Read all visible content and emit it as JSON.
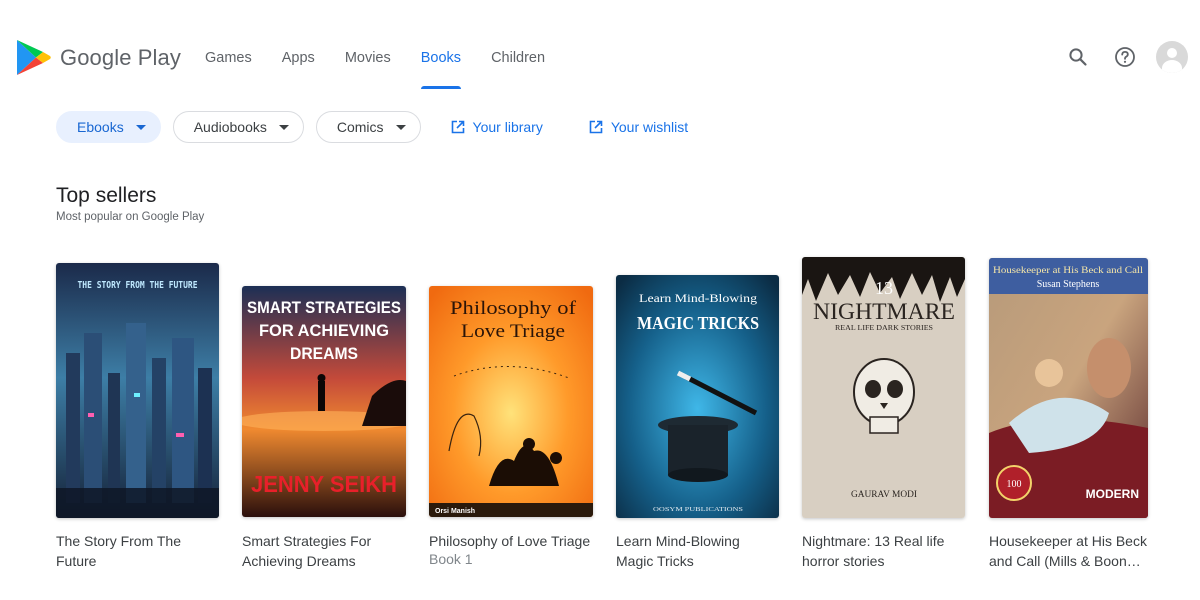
{
  "header": {
    "logo_text": "Google Play",
    "nav_tabs": [
      {
        "label": "Games"
      },
      {
        "label": "Apps"
      },
      {
        "label": "Movies"
      },
      {
        "label": "Books",
        "active": true
      },
      {
        "label": "Children"
      }
    ],
    "icons": [
      "search-icon",
      "help-icon",
      "avatar"
    ]
  },
  "filters": {
    "chips": [
      {
        "label": "Ebooks",
        "selected": true
      },
      {
        "label": "Audiobooks"
      },
      {
        "label": "Comics"
      }
    ],
    "links": [
      {
        "label": "Your library",
        "icon": "open-in-new-icon"
      },
      {
        "label": "Your wishlist",
        "icon": "open-in-new-icon"
      }
    ]
  },
  "section": {
    "title": "Top sellers",
    "subtitle": "Most popular on Google Play"
  },
  "books": [
    {
      "title": "The Story From The Future",
      "cover_text": "THE STORY FROM THE FUTURE"
    },
    {
      "title": "Smart Strategies For Achieving Dreams",
      "cover_text": "SMART STRATEGIES FOR ACHIEVING DREAMS",
      "cover_author": "JENNY SEIKH"
    },
    {
      "title": "Philosophy of Love Triage",
      "subtitle": "Book 1",
      "cover_text": "Philosophy of Love Triage",
      "cover_author": "Orsi Manish"
    },
    {
      "title": "Learn Mind-Blowing Magic Tricks",
      "cover_text_1": "Learn Mind-Blowing",
      "cover_text_2": "MAGIC TRICKS",
      "cover_publisher": "OOSYM PUBLICATIONS"
    },
    {
      "title": "Nightmare: 13 Real life horror stories",
      "cover_number": "13",
      "cover_text": "NIGHTMARE",
      "cover_sub": "REAL LIFE DARK STORIES",
      "cover_author": "GAURAV MODI"
    },
    {
      "title": "Housekeeper at His Beck and Call (Mills & Boon…",
      "cover_text": "Housekeeper at His Beck and Call",
      "cover_author": "Susan Stephens",
      "cover_brand": "MODERN"
    }
  ],
  "colors": {
    "accent": "#1a73e8",
    "chip_selected_bg": "#e8f0fe",
    "text_primary": "#202124",
    "text_secondary": "#5f6368"
  }
}
